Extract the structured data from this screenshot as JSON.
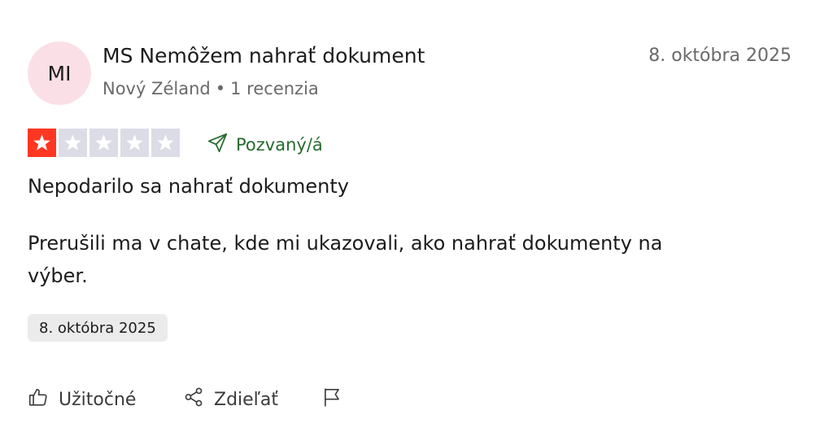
{
  "review": {
    "avatar_initials": "MI",
    "author_name": "MS Nemôžem nahrať dokument",
    "date": "8. októbra 2025",
    "country": "Nový Zéland",
    "separator": "•",
    "review_count": "1 recenzia",
    "rating": 1,
    "rating_max": 5,
    "invited_label": "Pozvaný/á",
    "title": "Nepodarilo sa nahrať dokumenty",
    "text": "Prerušili ma v chate, kde mi ukazovali, ako nahrať dokumenty na výber.",
    "experience_date": "8. októbra 2025"
  },
  "actions": {
    "useful_label": "Užitočné",
    "share_label": "Zdieľať"
  },
  "colors": {
    "star_filled": "#ff3722",
    "star_empty": "#dcdce6",
    "avatar_bg": "#fbdfe6",
    "invited": "#276b2f",
    "muted_text": "#696a6a"
  },
  "icons": {
    "star": "star-icon",
    "invited": "paper-plane-icon",
    "useful": "thumbs-up-icon",
    "share": "share-icon",
    "report": "flag-icon"
  }
}
